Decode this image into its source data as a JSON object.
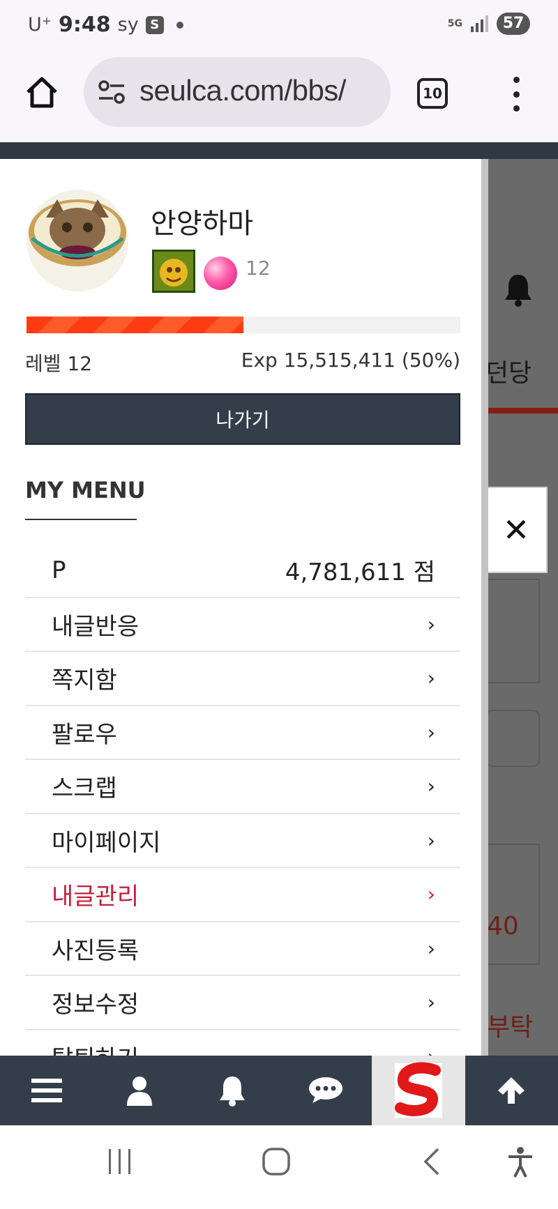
{
  "status_bar": {
    "carrier": "U⁺",
    "time": "9:48",
    "indicators": "sy",
    "app_chip": "S",
    "network": "5G",
    "battery": "57"
  },
  "browser": {
    "url": "seulca.com/bbs/",
    "tab_count": "10"
  },
  "background_page": {
    "visible_text_1": "던당",
    "visible_text_2": "0\u0000",
    "visible_text_3": "40",
    "visible_text_4": "부탁"
  },
  "profile": {
    "username": "안양하마",
    "badge_level": "12",
    "level_label": "레벨 12",
    "exp_label": "Exp 15,515,411 (50%)",
    "exp_progress": 0.5,
    "exit_label": "나가기"
  },
  "menu": {
    "heading": "MY MENU",
    "points_label": "P",
    "points_value": "4,781,611 점",
    "items": [
      {
        "label": "내글반응",
        "active": false
      },
      {
        "label": "쪽지함",
        "active": false
      },
      {
        "label": "팔로우",
        "active": false
      },
      {
        "label": "스크랩",
        "active": false
      },
      {
        "label": "마이페이지",
        "active": false
      },
      {
        "label": "내글관리",
        "active": true
      },
      {
        "label": "사진등록",
        "active": false
      },
      {
        "label": "정보수정",
        "active": false
      },
      {
        "label": "탈퇴하기",
        "active": false
      }
    ],
    "chevron": "›"
  },
  "close_glyph": "✕",
  "colors": {
    "accent_red": "#c0203a",
    "exp_fill": "#ff3b12",
    "toolbar_bg": "#343e4a"
  },
  "toolbar_icons": [
    "menu-icon",
    "user-icon",
    "bell-icon",
    "chat-icon",
    "site-logo",
    "arrow-up-icon"
  ],
  "nav_icons": [
    "recent-apps-icon",
    "home-icon",
    "back-icon",
    "accessibility-icon"
  ]
}
